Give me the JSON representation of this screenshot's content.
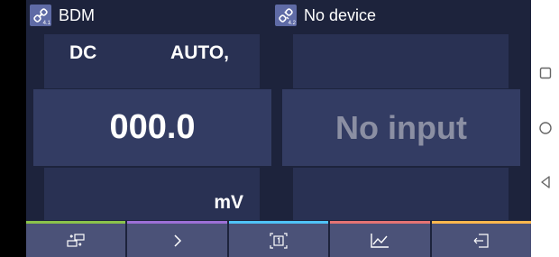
{
  "left_device": {
    "name": "BDM",
    "link_num": "4.1",
    "mode": "DC",
    "range": "AUTO,",
    "value": "000.0",
    "unit": "mV"
  },
  "right_device": {
    "name": "No device",
    "link_num": "4.2",
    "value": "No input"
  },
  "toolbar": {
    "buttons": [
      {
        "icon": "swap-devices-icon",
        "color": "#8bc34a"
      },
      {
        "icon": "chevron-right-icon",
        "color": "#9c6fd6"
      },
      {
        "icon": "screen-1-icon",
        "color": "#4fc3f7"
      },
      {
        "icon": "chart-icon",
        "color": "#e57373"
      },
      {
        "icon": "exit-icon",
        "color": "#ffb74d"
      }
    ]
  },
  "colors": {
    "background": "#1d233c",
    "panel": "#293153",
    "panel_bright": "#333c63",
    "toolbar": "#4b5278",
    "value_text": "#ffffff",
    "no_input_text": "#8b8fa3"
  }
}
